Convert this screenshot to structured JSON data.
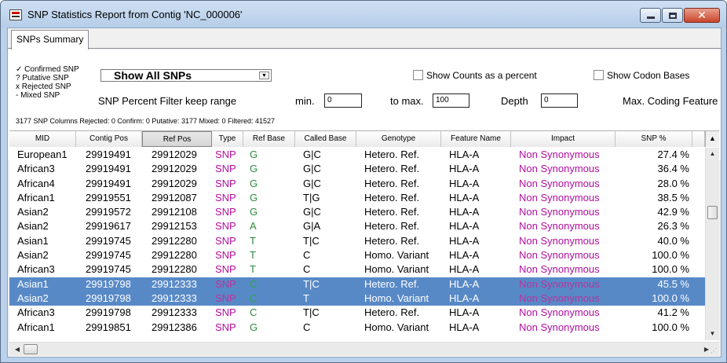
{
  "window": {
    "title": "SNP Statistics Report from Contig 'NC_000006'"
  },
  "tabs": [
    {
      "label": "SNPs Summary"
    }
  ],
  "legend": {
    "confirmed": "✓ Confirmed SNP",
    "putative": "? Putative SNP",
    "rejected": "x Rejected SNP",
    "mixed": "- Mixed SNP"
  },
  "filter": {
    "show_select": "Show All SNPs",
    "show_counts_percent": "Show Counts as a percent",
    "show_codon_bases": "Show Codon Bases",
    "percent_filter_label": "SNP Percent Filter  keep range",
    "min_label": "min.",
    "min_value": "0",
    "max_label": "to max.",
    "max_value": "100",
    "depth_label": "Depth",
    "depth_value": "0",
    "max_coding_label": "Max. Coding Feature"
  },
  "stats": "3177 SNP Columns Rejected: 0 Confirm: 0 Putative: 3177 Mixed: 0 Filtered: 41527",
  "columns": [
    "MID",
    "Contig Pos",
    "Ref Pos",
    "Type",
    "Ref Base",
    "Called Base",
    "Genotype",
    "Feature Name",
    "Impact",
    "SNP %"
  ],
  "rows": [
    {
      "mid": "European1",
      "contig": "29919491",
      "ref": "29912029",
      "type": "SNP",
      "refb": "G",
      "called": "G|C",
      "geno": "Hetero. Ref.",
      "feat": "HLA-A",
      "impact": "Non Synonymous",
      "pct": "27.4 %",
      "selected": false
    },
    {
      "mid": "African3",
      "contig": "29919491",
      "ref": "29912029",
      "type": "SNP",
      "refb": "G",
      "called": "G|C",
      "geno": "Hetero. Ref.",
      "feat": "HLA-A",
      "impact": "Non Synonymous",
      "pct": "36.4 %",
      "selected": false
    },
    {
      "mid": "African4",
      "contig": "29919491",
      "ref": "29912029",
      "type": "SNP",
      "refb": "G",
      "called": "G|C",
      "geno": "Hetero. Ref.",
      "feat": "HLA-A",
      "impact": "Non Synonymous",
      "pct": "28.0 %",
      "selected": false
    },
    {
      "mid": "African1",
      "contig": "29919551",
      "ref": "29912087",
      "type": "SNP",
      "refb": "G",
      "called": "T|G",
      "geno": "Hetero. Ref.",
      "feat": "HLA-A",
      "impact": "Non Synonymous",
      "pct": "38.5 %",
      "selected": false
    },
    {
      "mid": "Asian2",
      "contig": "29919572",
      "ref": "29912108",
      "type": "SNP",
      "refb": "G",
      "called": "G|C",
      "geno": "Hetero. Ref.",
      "feat": "HLA-A",
      "impact": "Non Synonymous",
      "pct": "42.9 %",
      "selected": false
    },
    {
      "mid": "Asian2",
      "contig": "29919617",
      "ref": "29912153",
      "type": "SNP",
      "refb": "A",
      "called": "G|A",
      "geno": "Hetero. Ref.",
      "feat": "HLA-A",
      "impact": "Non Synonymous",
      "pct": "26.3 %",
      "selected": false
    },
    {
      "mid": "Asian1",
      "contig": "29919745",
      "ref": "29912280",
      "type": "SNP",
      "refb": "T",
      "called": "T|C",
      "geno": "Hetero. Ref.",
      "feat": "HLA-A",
      "impact": "Non Synonymous",
      "pct": "40.0 %",
      "selected": false
    },
    {
      "mid": "Asian2",
      "contig": "29919745",
      "ref": "29912280",
      "type": "SNP",
      "refb": "T",
      "called": "C",
      "geno": "Homo. Variant",
      "feat": "HLA-A",
      "impact": "Non Synonymous",
      "pct": "100.0 %",
      "selected": false
    },
    {
      "mid": "African3",
      "contig": "29919745",
      "ref": "29912280",
      "type": "SNP",
      "refb": "T",
      "called": "C",
      "geno": "Homo. Variant",
      "feat": "HLA-A",
      "impact": "Non Synonymous",
      "pct": "100.0 %",
      "selected": false
    },
    {
      "mid": "Asian1",
      "contig": "29919798",
      "ref": "29912333",
      "type": "SNP",
      "refb": "C",
      "called": "T|C",
      "geno": "Hetero. Ref.",
      "feat": "HLA-A",
      "impact": "Non Synonymous",
      "pct": "45.5 %",
      "selected": true
    },
    {
      "mid": "Asian2",
      "contig": "29919798",
      "ref": "29912333",
      "type": "SNP",
      "refb": "C",
      "called": "T",
      "geno": "Homo. Variant",
      "feat": "HLA-A",
      "impact": "Non Synonymous",
      "pct": "100.0 %",
      "selected": true
    },
    {
      "mid": "African3",
      "contig": "29919798",
      "ref": "29912333",
      "type": "SNP",
      "refb": "C",
      "called": "T|C",
      "geno": "Hetero. Ref.",
      "feat": "HLA-A",
      "impact": "Non Synonymous",
      "pct": "41.2 %",
      "selected": false
    },
    {
      "mid": "African1",
      "contig": "29919851",
      "ref": "29912386",
      "type": "SNP",
      "refb": "G",
      "called": "C",
      "geno": "Homo. Variant",
      "feat": "HLA-A",
      "impact": "Non Synonymous",
      "pct": "100.0 %",
      "selected": false
    }
  ],
  "colors": {
    "selection": "#5889c7",
    "type_impact_text": "#b10d9e",
    "ref_base_text": "#2a8a3a"
  },
  "icons": [
    "app-icon",
    "minimize-icon",
    "maximize-icon",
    "close-icon",
    "dropdown-arrow-icon",
    "scroll-up-icon",
    "scroll-down-icon",
    "scroll-left-icon",
    "scroll-right-icon",
    "column-chooser-icon"
  ]
}
